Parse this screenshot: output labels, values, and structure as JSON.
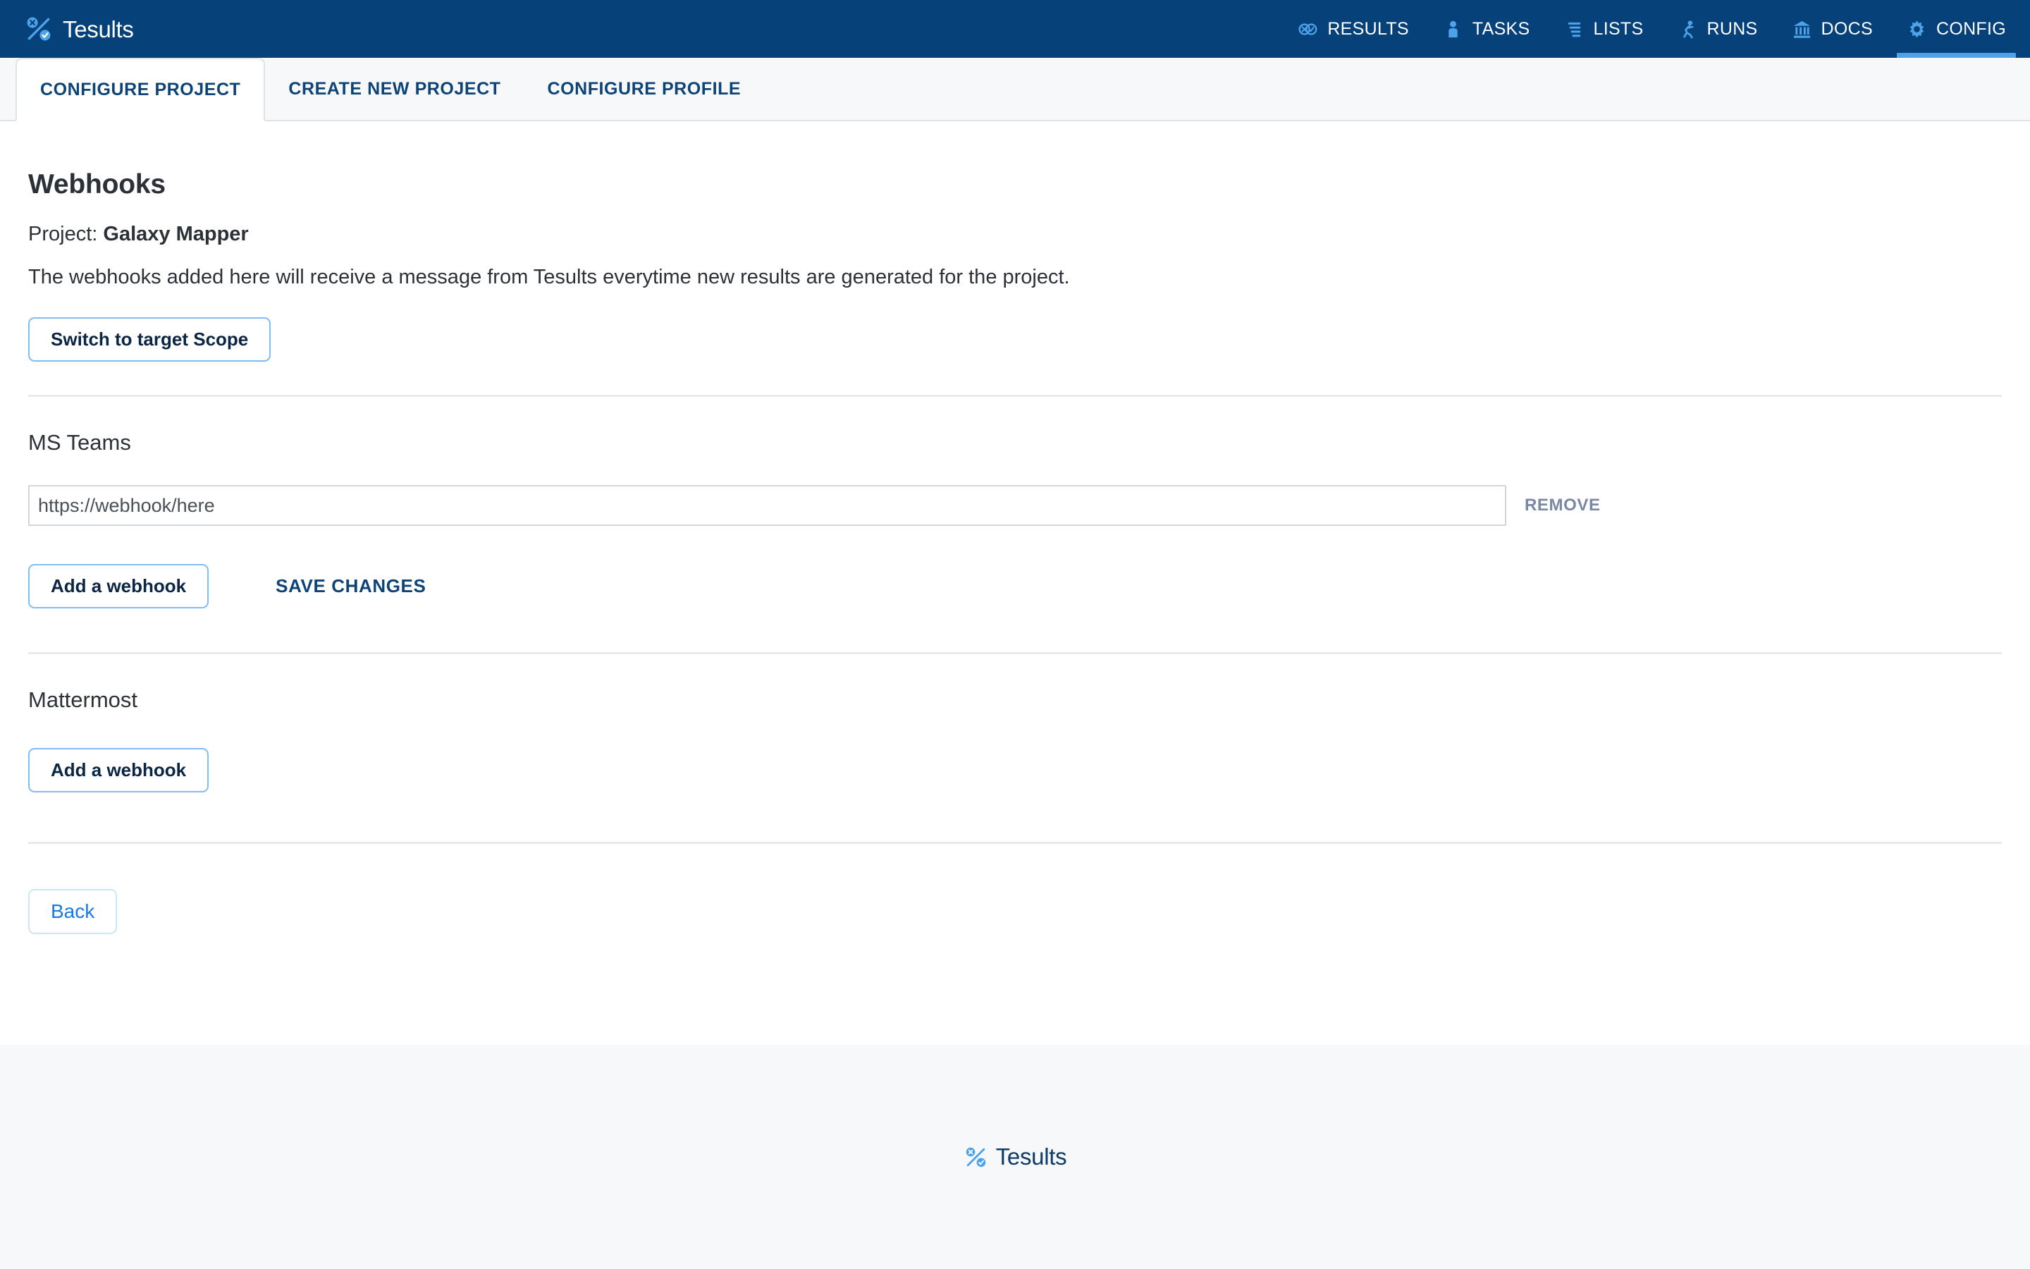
{
  "header": {
    "brand": {
      "name": "Tesults",
      "icon": "tesults-percent-logo-icon"
    },
    "nav": [
      {
        "label": "RESULTS",
        "icon": "results-circles-icon",
        "active": false
      },
      {
        "label": "TASKS",
        "icon": "person-icon",
        "active": false
      },
      {
        "label": "LISTS",
        "icon": "list-lines-icon",
        "active": false
      },
      {
        "label": "RUNS",
        "icon": "running-person-icon",
        "active": false
      },
      {
        "label": "DOCS",
        "icon": "bank-columns-icon",
        "active": false
      },
      {
        "label": "CONFIG",
        "icon": "gear-icon",
        "active": true
      }
    ],
    "colors": {
      "background": "#064179",
      "active_underline": "#4da3ea",
      "text": "#ffffff"
    }
  },
  "tabs": [
    {
      "label": "CONFIGURE PROJECT",
      "active": true
    },
    {
      "label": "CREATE NEW PROJECT",
      "active": false
    },
    {
      "label": "CONFIGURE PROFILE",
      "active": false
    }
  ],
  "main": {
    "page_title": "Webhooks",
    "project_label": "Project:",
    "project_name": "Galaxy Mapper",
    "description": "The webhooks added here will receive a message from Tesults everytime new results are generated for the project.",
    "switch_scope_button": "Switch to target Scope",
    "sections": [
      {
        "title": "MS Teams",
        "webhooks": [
          {
            "value": "",
            "placeholder": "https://webhook/here",
            "remove_label": "REMOVE"
          }
        ],
        "add_button": "Add a webhook",
        "save_link": "SAVE CHANGES"
      },
      {
        "title": "Mattermost",
        "webhooks": [],
        "add_button": "Add a webhook",
        "save_link": null
      }
    ],
    "back_button": "Back"
  },
  "footer": {
    "brand_name": "Tesults",
    "icon": "tesults-percent-logo-icon",
    "background": "#f6f8fa"
  }
}
